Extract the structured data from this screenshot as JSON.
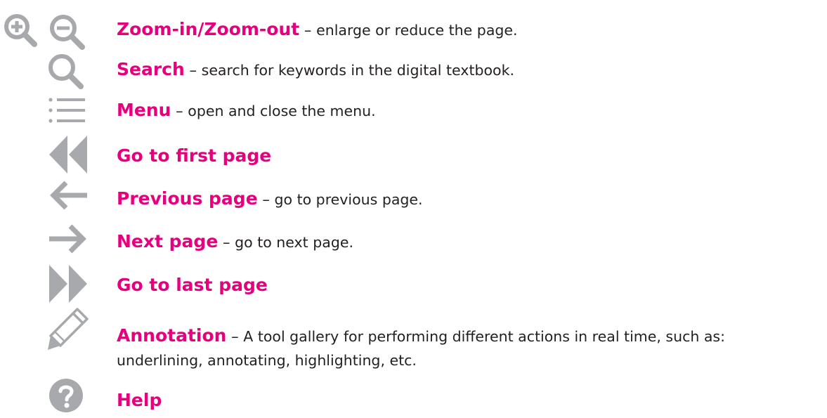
{
  "colors": {
    "accent": "#e6007e",
    "icon": "#a7a9ac",
    "text": "#231f20"
  },
  "items": [
    {
      "icon": "zoom-in-zoom-out-icon",
      "title": "Zoom-in/Zoom-out",
      "sep": " – ",
      "desc": "enlarge or reduce the page."
    },
    {
      "icon": "search-icon",
      "title": "Search",
      "sep": " – ",
      "desc": "search for keywords in the digital textbook."
    },
    {
      "icon": "menu-list-icon",
      "title": "Menu",
      "sep": " – ",
      "desc": "open and close the menu."
    },
    {
      "icon": "first-page-icon",
      "title": "Go to first page",
      "sep": "",
      "desc": ""
    },
    {
      "icon": "arrow-left-icon",
      "title": "Previous page",
      "sep": " – ",
      "desc": "go to previous page."
    },
    {
      "icon": "arrow-right-icon",
      "title": "Next page",
      "sep": " – ",
      "desc": "go to next page."
    },
    {
      "icon": "last-page-icon",
      "title": "Go to last page",
      "sep": "",
      "desc": ""
    },
    {
      "icon": "pencil-icon",
      "title": "Annotation",
      "sep": " – ",
      "desc": "A tool gallery for performing different actions in real time, such as:",
      "desc2": "underlining, annotating, highlighting, etc."
    },
    {
      "icon": "help-icon",
      "title": "Help",
      "sep": "",
      "desc": ""
    }
  ]
}
